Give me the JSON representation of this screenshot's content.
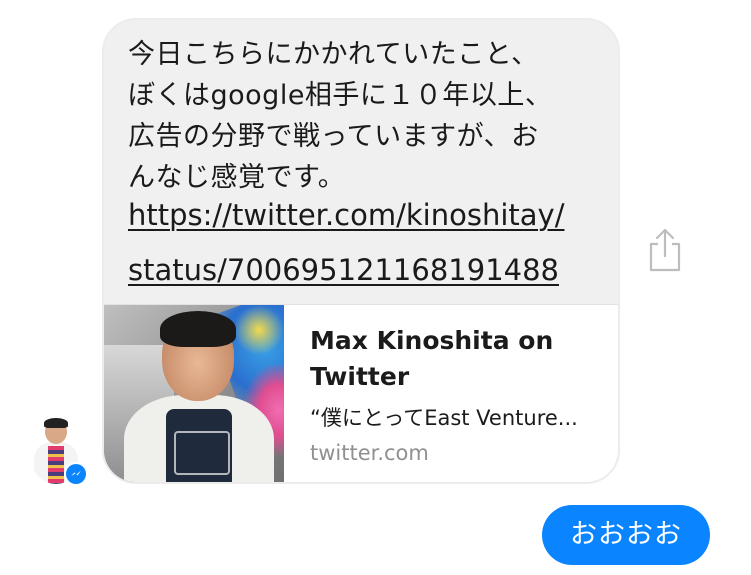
{
  "conversation": {
    "incoming_message": {
      "text": "今日こちらにかかれていたこと、\nぼくはgoogle相手に１０年以上、\n広告の分野で戦っていますが、お\nんなじ感覚です。",
      "link_line_1": "https://twitter.com/kinoshitay/",
      "link_line_2": "status/700695121168191488",
      "preview": {
        "title": "Max Kinoshita on Twitter",
        "description": "“僕にとってEast Venture...",
        "domain": "twitter.com"
      }
    },
    "outgoing_message": {
      "text": "おおおお"
    }
  },
  "icons": {
    "share": "share-icon",
    "messenger_badge": "messenger-icon"
  },
  "colors": {
    "incoming_bubble": "#f0f0f0",
    "outgoing_bubble": "#0b84ff",
    "messenger_blue": "#0a84ff",
    "muted_text": "#909090"
  }
}
